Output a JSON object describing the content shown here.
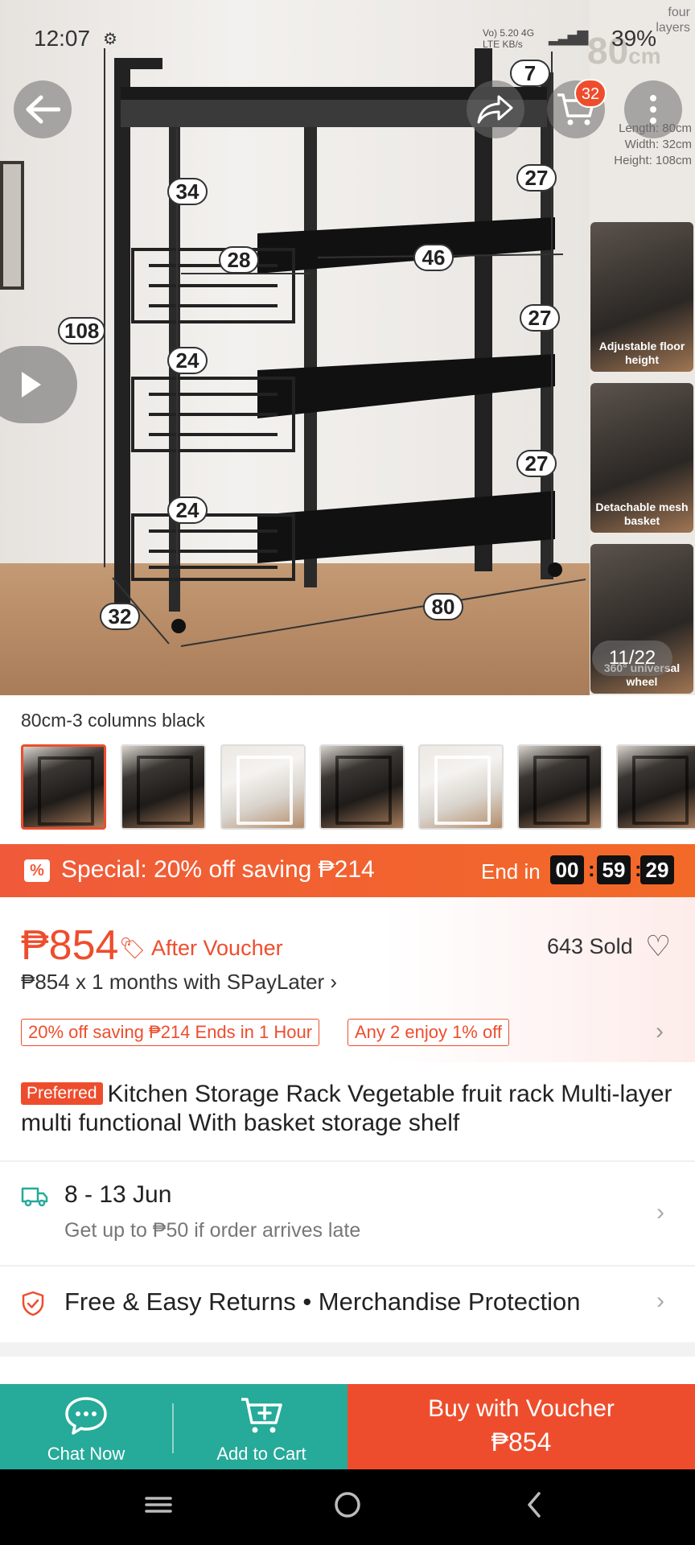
{
  "status_bar": {
    "time": "12:07",
    "net_line1": "Vo) 5.20 4G",
    "net_line2": "LTE KB/s",
    "battery": "39%"
  },
  "hero": {
    "corner_text": "four layers",
    "big_size": "80",
    "big_unit": "cm",
    "spec_length": "Length: 80cm",
    "spec_width": "Width: 32cm",
    "spec_height": "Height: 108cm",
    "side_captions": [
      "Adjustable floor height",
      "Detachable mesh basket",
      "360° universal wheel"
    ],
    "dimension_labels": {
      "top": "7",
      "h108": "108",
      "d34": "34",
      "w28": "28",
      "d24a": "24",
      "d24b": "24",
      "w46": "46",
      "r27a": "27",
      "r27b": "27",
      "r27c": "27",
      "depth": "32",
      "width": "80"
    },
    "image_counter": "11/22",
    "cart_count": "32"
  },
  "variant": {
    "name": "80cm-3 columns black",
    "thumbnail_colors": [
      "black",
      "black",
      "white",
      "black",
      "white",
      "black",
      "black"
    ],
    "selected_index": 0
  },
  "flash_sale": {
    "icon": "%",
    "text": "Special: 20% off saving ₱214",
    "end_label": "End in",
    "hours": "00",
    "minutes": "59",
    "seconds": "29"
  },
  "price": {
    "amount": "₱854",
    "after_voucher": "After Voucher",
    "sold": "643 Sold",
    "paylater": "₱854 x 1 months with SPayLater ›",
    "tags": [
      "20% off saving ₱214 Ends in 1 Hour",
      "Any 2 enjoy 1% off"
    ]
  },
  "product": {
    "badge": "Preferred",
    "title": "Kitchen Storage Rack Vegetable fruit rack Multi-layer multi functional With basket storage shelf"
  },
  "delivery": {
    "date": "8 - 13 Jun",
    "note": "Get up to ₱50 if order arrives late"
  },
  "returns": {
    "text": "Free & Easy Returns  •  Merchandise Protection"
  },
  "bottom_bar": {
    "chat": "Chat Now",
    "cart": "Add to Cart",
    "buy_line1": "Buy with Voucher",
    "buy_line2": "₱854"
  },
  "colors": {
    "accent": "#ee4d2d",
    "green": "#26aa99",
    "flash": "#f05a3a"
  }
}
